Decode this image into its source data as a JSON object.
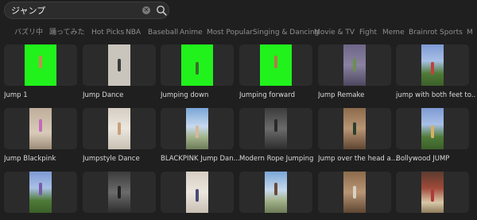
{
  "search": {
    "value": "ジャンプ"
  },
  "tabs": [
    "バズリ中",
    "踊ってみた",
    "Hot Picks",
    "NBA",
    "Baseball",
    "Anime",
    "Most Popular",
    "Singing & Dancing",
    "Movie & TV",
    "Fight",
    "Meme",
    "Brainrot",
    "Sports",
    "M"
  ],
  "rows": [
    [
      {
        "title": "Jump 1",
        "thumb": "green",
        "figure": "#c98a55"
      },
      {
        "title": "Jump Dance",
        "thumb": "light",
        "figure": "#3a3a3a"
      },
      {
        "title": "Jumping down",
        "thumb": "green",
        "figure": "#3a6d2e"
      },
      {
        "title": "Jumping forward",
        "thumb": "green",
        "figure": "#b07a4a"
      },
      {
        "title": "Jump Remake",
        "thumb": "purple",
        "figure": "#6b8f4e"
      },
      {
        "title": "jump with both feet to...",
        "thumb": "field",
        "figure": "#c04040"
      }
    ],
    [
      {
        "title": "Jump Blackpink",
        "thumb": "room",
        "figure": "#c46ab8"
      },
      {
        "title": "Jumpstyle Dance",
        "thumb": "beige",
        "figure": "#c9a07a"
      },
      {
        "title": "BLACKPINK Jump Dan...",
        "thumb": "sky",
        "figure": "#d4b89a"
      },
      {
        "title": "Modern Rope Jumping",
        "thumb": "dark",
        "figure": "#2a2a2a"
      },
      {
        "title": "Jump over the head a...",
        "thumb": "wood",
        "figure": "#2b3f2b"
      },
      {
        "title": "Bollywood JUMP",
        "thumb": "field",
        "figure": "#d9b060"
      }
    ],
    [
      {
        "title": "",
        "thumb": "field",
        "figure": "#7a5aa8"
      },
      {
        "title": "",
        "thumb": "dark",
        "figure": "#1f1f1f"
      },
      {
        "title": "",
        "thumb": "beige",
        "figure": "#4a4a7a"
      },
      {
        "title": "",
        "thumb": "sky",
        "figure": "#6b4a3a"
      },
      {
        "title": "",
        "thumb": "wood",
        "figure": "#d9d0c0"
      },
      {
        "title": "",
        "thumb": "stage",
        "figure": "#b03a3a"
      }
    ]
  ]
}
